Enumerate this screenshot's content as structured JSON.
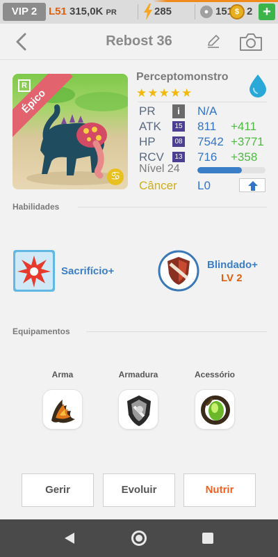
{
  "topbar": {
    "vip": "VIP 2",
    "level": "L51",
    "power": "315,0K",
    "power_unit": "PR",
    "energy": "285",
    "paws": "151K",
    "coins": "2",
    "add": "+"
  },
  "header": {
    "title": "Rebost 36",
    "back_icon": "chevron-left-icon",
    "edit_icon": "pencil-icon",
    "camera_icon": "camera-icon"
  },
  "monster": {
    "name": "Perceptomonstro",
    "stars": "★★★★★",
    "star_count": 5,
    "rarity": "Épico",
    "rarity_badge": "R",
    "element_icon": "water-drop-icon",
    "sign_icon": "cancer-icon",
    "stats": [
      {
        "key": "PR",
        "badge": "i",
        "value": "N/A",
        "bonus": ""
      },
      {
        "key": "ATK",
        "badge": "15",
        "value": "811",
        "bonus": "+411"
      },
      {
        "key": "HP",
        "badge": "08",
        "value": "7542",
        "bonus": "+3771"
      },
      {
        "key": "RCV",
        "badge": "13",
        "value": "716",
        "bonus": "+358"
      }
    ],
    "level_label": "Nível 24",
    "level_progress": 0.65,
    "sign": "Câncer",
    "loyalty": "L0",
    "upgrade_icon": "arrow-up-icon"
  },
  "skills": {
    "heading": "Habilidades",
    "items": [
      {
        "name": "Sacrifício+",
        "level": ""
      },
      {
        "name": "Blindado+",
        "level": "LV 2"
      }
    ]
  },
  "equipment": {
    "heading": "Equipamentos",
    "slots": [
      {
        "label": "Arma",
        "icon": "weapon-icon"
      },
      {
        "label": "Armadura",
        "icon": "armor-icon"
      },
      {
        "label": "Acessório",
        "icon": "accessory-icon"
      }
    ]
  },
  "actions": {
    "manage": "Gerir",
    "evolve": "Evoluir",
    "feed": "Nutrir"
  },
  "colors": {
    "accent_blue": "#3274c8",
    "bonus_green": "#4cbb3e",
    "feed_orange": "#f06020",
    "star_gold": "#f2b90c",
    "rarity_pink": "#e2636e"
  }
}
